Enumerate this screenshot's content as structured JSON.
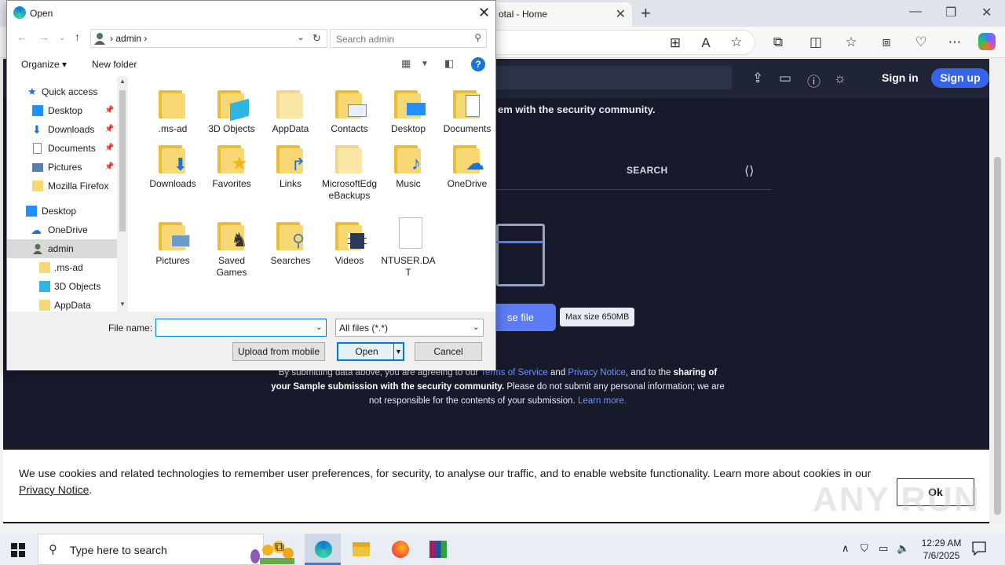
{
  "browser": {
    "tab_title": "otal - Home",
    "toolbar_icons": [
      "apps-icon",
      "read-aloud-icon",
      "favorite-star-icon",
      "extensions-icon",
      "split-screen-icon",
      "favorites-icon",
      "collections-icon",
      "browser-essentials-icon",
      "more-icon",
      "copilot-icon"
    ]
  },
  "page": {
    "sign_in": "Sign in",
    "sign_up": "Sign up",
    "intro_text": "em with the security community.",
    "search_tab": "SEARCH",
    "choose_file": "se file",
    "max_size": "Max size 650MB",
    "terms": {
      "t1": "By submitting data above, you are agreeing to our ",
      "l1": "Terms of Service",
      "t2": " and ",
      "l2": "Privacy Notice",
      "t3": ", and to the ",
      "b1": "sharing of your Sample submission with the security community.",
      "t4": " Please do not submit any personal information; we are not responsible for the contents of your submission. ",
      "l3": "Learn more."
    }
  },
  "cookie": {
    "text": "We use cookies and related technologies to remember user preferences, for security, to analyse our traffic, and to enable website functionality. Learn more about cookies in our ",
    "link": "Privacy Notice",
    "end": ".",
    "ok": "Ok"
  },
  "watermark": "ANY RUN",
  "dialog": {
    "title": "Open",
    "path_segment": "admin",
    "search_placeholder": "Search admin",
    "organize": "Organize ▾",
    "new_folder": "New folder",
    "nav": [
      {
        "label": "Quick access",
        "icon": "star-icon",
        "pinned": false
      },
      {
        "label": "Desktop",
        "icon": "desktop-icon",
        "pinned": true
      },
      {
        "label": "Downloads",
        "icon": "downloads-icon",
        "pinned": true
      },
      {
        "label": "Documents",
        "icon": "documents-icon",
        "pinned": true
      },
      {
        "label": "Pictures",
        "icon": "pictures-icon",
        "pinned": true
      },
      {
        "label": "Mozilla Firefox",
        "icon": "folder-icon",
        "pinned": false
      },
      {
        "label": "Desktop",
        "icon": "desktop-icon",
        "pinned": false
      },
      {
        "label": "OneDrive",
        "icon": "onedrive-icon",
        "pinned": false
      },
      {
        "label": "admin",
        "icon": "user-icon",
        "pinned": false,
        "selected": true
      },
      {
        "label": ".ms-ad",
        "icon": "folder-icon",
        "pinned": false
      },
      {
        "label": "3D Objects",
        "icon": "3d-objects-icon",
        "pinned": false
      },
      {
        "label": "AppData",
        "icon": "folder-icon",
        "pinned": false
      }
    ],
    "items": [
      {
        "label": ".ms-ad",
        "icon": "folder-icon"
      },
      {
        "label": "3D Objects",
        "icon": "3d-objects-folder-icon"
      },
      {
        "label": "AppData",
        "icon": "folder-icon"
      },
      {
        "label": "Contacts",
        "icon": "contacts-folder-icon"
      },
      {
        "label": "Desktop",
        "icon": "desktop-folder-icon"
      },
      {
        "label": "Documents",
        "icon": "documents-folder-icon"
      },
      {
        "label": "Downloads",
        "icon": "downloads-folder-icon"
      },
      {
        "label": "Favorites",
        "icon": "favorites-folder-icon"
      },
      {
        "label": "Links",
        "icon": "links-folder-icon"
      },
      {
        "label": "MicrosoftEdgeBackups",
        "icon": "folder-icon"
      },
      {
        "label": "Music",
        "icon": "music-folder-icon"
      },
      {
        "label": "OneDrive",
        "icon": "onedrive-folder-icon"
      },
      {
        "label": "Pictures",
        "icon": "pictures-folder-icon"
      },
      {
        "label": "Saved Games",
        "icon": "saved-games-folder-icon"
      },
      {
        "label": "Searches",
        "icon": "searches-folder-icon"
      },
      {
        "label": "Videos",
        "icon": "videos-folder-icon"
      },
      {
        "label": "NTUSER.DAT",
        "icon": "file-icon"
      }
    ],
    "file_name_label": "File name:",
    "file_name_value": "",
    "file_type": "All files (*.*)",
    "upload_mobile": "Upload from mobile",
    "open": "Open",
    "cancel": "Cancel"
  },
  "taskbar": {
    "search_placeholder": "Type here to search",
    "time": "12:29 AM",
    "date": "7/6/2025"
  },
  "colors": {
    "accent": "#0078d7",
    "vt_blue": "#5b7cf5",
    "folder": "#f8d775",
    "page_bg": "#171a2b"
  }
}
